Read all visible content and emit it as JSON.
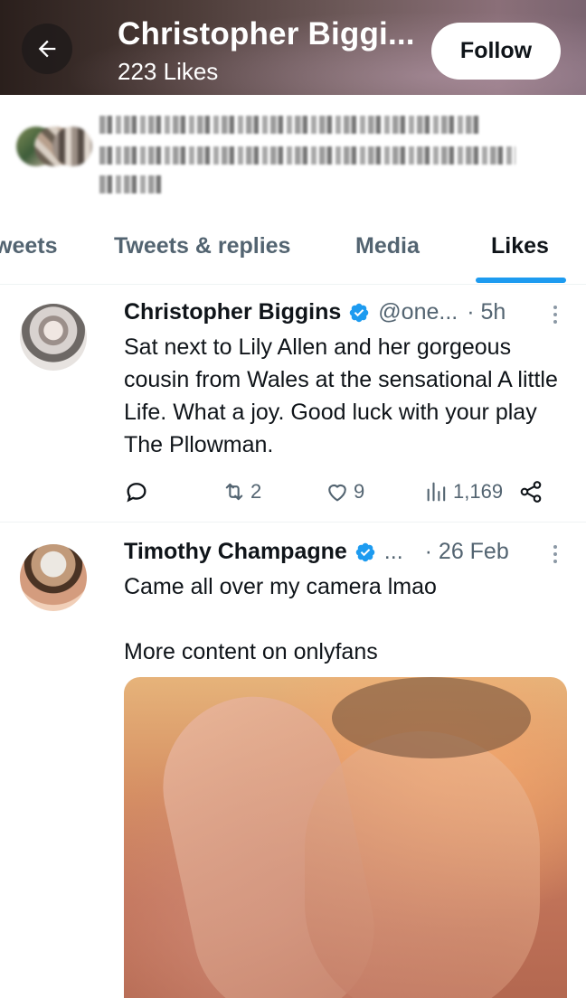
{
  "header": {
    "title": "Christopher Biggi...",
    "subtitle": "223 Likes",
    "follow_label": "Follow"
  },
  "tabs": [
    {
      "label": "weets",
      "active": false
    },
    {
      "label": "Tweets & replies",
      "active": false
    },
    {
      "label": "Media",
      "active": false
    },
    {
      "label": "Likes",
      "active": true
    }
  ],
  "tweets": [
    {
      "author": "Christopher Biggins",
      "handle": "@one...",
      "time": "· 5h",
      "text": "Sat next to Lily Allen and her gorgeous cousin from Wales at the sensational A little Life. What a joy. Good luck with your play The Pllowman.",
      "actions": {
        "reply_count": "",
        "retweet_count": "2",
        "like_count": "9",
        "view_count": "1,169"
      }
    },
    {
      "author": "Timothy Champagne",
      "handle": "...",
      "time": "· 26 Feb",
      "text": "Came all over my camera lmao\n\nMore content on onlyfans"
    }
  ],
  "colors": {
    "accent": "#1d9bf0",
    "text_primary": "#0f1419",
    "text_secondary": "#536471"
  },
  "icons": [
    "back-arrow-icon",
    "verified-icon",
    "more-icon",
    "reply-icon",
    "retweet-icon",
    "like-icon",
    "views-icon",
    "share-icon"
  ]
}
